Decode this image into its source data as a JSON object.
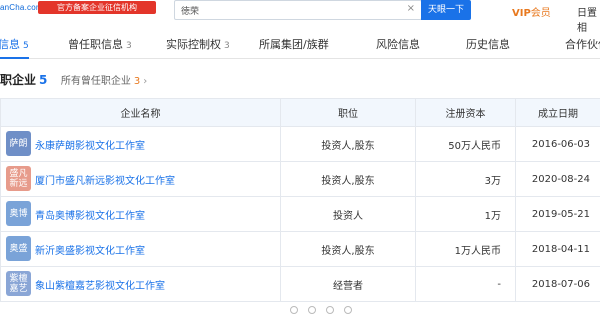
{
  "header": {
    "logo": "anCha.com",
    "banner": "官方备案企业征信机构",
    "search_value": "徳荣",
    "search_button": "天眼一下",
    "vip_label": "VIP",
    "vip_sub": "会员",
    "tail_text": "日置相"
  },
  "tabs": [
    {
      "label": "信息",
      "count": "5"
    },
    {
      "label": "曾任职信息",
      "count": "3"
    },
    {
      "label": "实际控制权",
      "count": "3"
    },
    {
      "label": "所属集团/族群",
      "count": ""
    },
    {
      "label": "风险信息",
      "count": ""
    },
    {
      "label": "历史信息",
      "count": ""
    },
    {
      "label": "合作伙伴",
      "count": ""
    }
  ],
  "section": {
    "title": "职企业",
    "count": "5",
    "other_label": "所有曾任职企业",
    "other_count": "3"
  },
  "table": {
    "headers": [
      "企业名称",
      "职位",
      "注册资本",
      "成立日期"
    ],
    "rows": [
      {
        "avatar": "萨朗",
        "avatar_color": "#6f8fc7",
        "name": "永康萨朗影视文化工作室",
        "position": "投资人,股东",
        "capital": "50万人民币",
        "date": "2016-06-03"
      },
      {
        "avatar": "盛凡新远",
        "avatar_color": "#e79b8b",
        "name": "厦门市盛凡新远影视文化工作室",
        "position": "投资人,股东",
        "capital": "3万",
        "date": "2020-08-24"
      },
      {
        "avatar": "奥博",
        "avatar_color": "#7aa3d8",
        "name": "青岛奥博影视文化工作室",
        "position": "投资人",
        "capital": "1万",
        "date": "2019-05-21"
      },
      {
        "avatar": "奥盛",
        "avatar_color": "#7aa3d8",
        "name": "新沂奥盛影视文化工作室",
        "position": "投资人,股东",
        "capital": "1万人民币",
        "date": "2018-04-11"
      },
      {
        "avatar": "紫檀嘉艺",
        "avatar_color": "#8aa6d6",
        "name": "象山紫檀嘉艺影视文化工作室",
        "position": "经营者",
        "capital": "-",
        "date": "2018-07-06"
      }
    ]
  }
}
